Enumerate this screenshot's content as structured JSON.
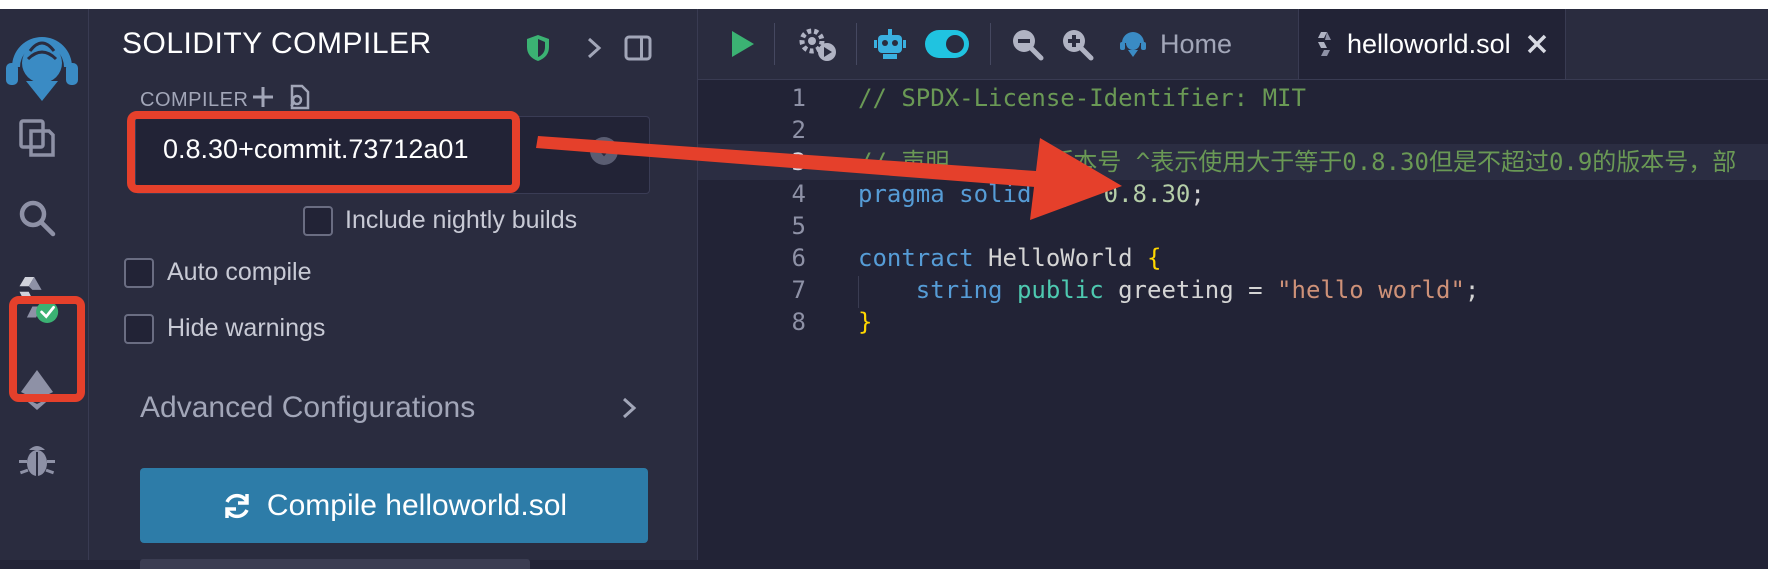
{
  "panel": {
    "title": "SOLIDITY COMPILER",
    "compiler_label": "COMPILER",
    "compiler_version": "0.8.30+commit.73712a01",
    "include_nightly_label": "Include nightly builds",
    "auto_compile_label": "Auto compile",
    "hide_warnings_label": "Hide warnings",
    "advanced_label": "Advanced Configurations",
    "compile_button_label": "Compile helloworld.sol"
  },
  "tabs": {
    "home_label": "Home",
    "file_label": "helloworld.sol"
  },
  "editor": {
    "line_numbers": [
      "1",
      "2",
      "3",
      "4",
      "5",
      "6",
      "7",
      "8"
    ],
    "l1": "// SPDX-License-Identifier: MIT",
    "l3a": "// 声明",
    "l3b": "版本号 ^表示使用大于等于0.8.30但是不超过0.9的版本号，部",
    "l4_kw1": "pragma",
    "l4_kw2": "solidity",
    "l4_caret": "^",
    "l4_ver": "0.8.30",
    "l4_semi": ";",
    "l6_kw": "contract",
    "l6_name": " HelloWorld ",
    "l6_brace": "{",
    "l7_type": "string",
    "l7_vis": "public",
    "l7_name": " greeting = ",
    "l7_str": "\"hello world\"",
    "l7_semi": ";",
    "l8_brace": "}"
  },
  "colors": {
    "accent_blue": "#2d7ca8",
    "success_green": "#3bb273",
    "annotation_red": "#e5402b",
    "toggle_cyan": "#20c3e0"
  },
  "icons": {
    "rail": [
      "remix-logo-icon",
      "file-explorer-icon",
      "search-icon",
      "solidity-compiler-icon",
      "deploy-run-icon",
      "debugger-icon"
    ],
    "header": [
      "shield-icon",
      "chevron-right-icon",
      "panel-toggle-icon"
    ],
    "tabbar": [
      "run-icon",
      "run-settings-icon",
      "ai-robot-icon",
      "ai-toggle-icon",
      "zoom-out-icon",
      "zoom-in-icon",
      "home-icon",
      "solidity-file-icon",
      "close-icon"
    ]
  }
}
